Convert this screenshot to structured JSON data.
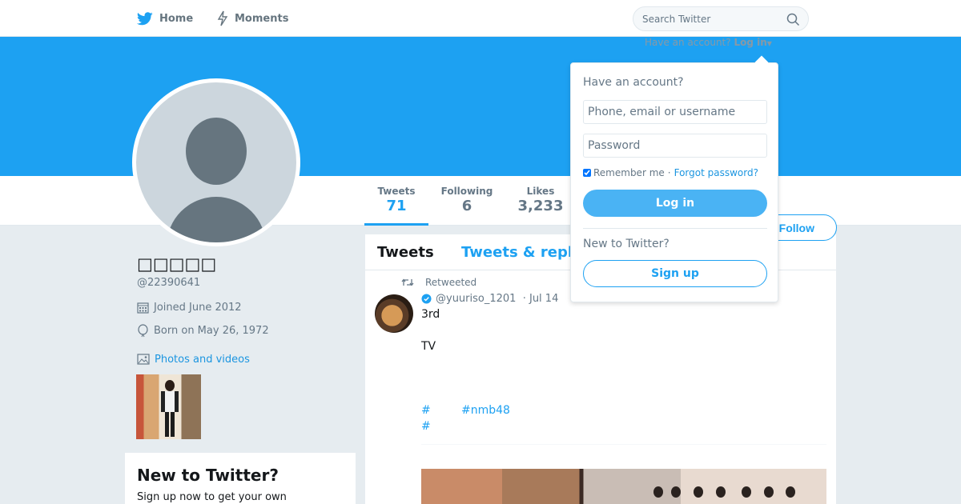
{
  "colors": {
    "accent": "#1da1f2",
    "banner": "#1da1f2",
    "muted": "#657786",
    "background": "#e6ecf0"
  },
  "nav": {
    "home_label": "Home",
    "moments_label": "Moments",
    "search_placeholder": "Search Twitter"
  },
  "login_hint": {
    "text": "Have an account?",
    "link": "Log in"
  },
  "profile": {
    "name": "□□□□□",
    "handle": "@22390641",
    "joined": "Joined June 2012",
    "born": "Born on May 26, 1972",
    "photos_label": "Photos and videos"
  },
  "stats": [
    {
      "label": "Tweets",
      "value": "71"
    },
    {
      "label": "Following",
      "value": "6"
    },
    {
      "label": "Likes",
      "value": "3,233"
    }
  ],
  "follow_label": "Follow",
  "signup_card": {
    "title": "New to Twitter?",
    "text": "Sign up now to get your own"
  },
  "timeline": {
    "tabs": [
      "Tweets",
      "Tweets & repl"
    ],
    "tweet": {
      "retweeted_label": "Retweeted",
      "author": "@yuuriso_1201",
      "date": "· Jul 14",
      "lines": [
        "3rd",
        "TV"
      ],
      "hashtags": [
        "#",
        "#nmb48",
        "#"
      ]
    }
  },
  "login_dropdown": {
    "title": "Have an account?",
    "username_placeholder": "Phone, email or username",
    "password_placeholder": "Password",
    "remember_label": "Remember me",
    "separator": "·",
    "forgot_label": "Forgot password?",
    "login_button": "Log in",
    "new_label": "New to Twitter?",
    "signup_button": "Sign up"
  }
}
